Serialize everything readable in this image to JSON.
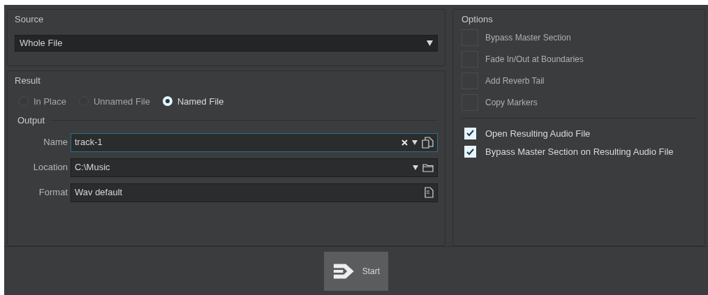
{
  "source": {
    "title": "Source",
    "value": "Whole File"
  },
  "result": {
    "title": "Result",
    "modes": [
      {
        "label": "In Place",
        "selected": false
      },
      {
        "label": "Unnamed File",
        "selected": false
      },
      {
        "label": "Named File",
        "selected": true
      }
    ],
    "output": {
      "title": "Output",
      "fields": [
        {
          "kind": "name",
          "label": "Name",
          "value": "track-1",
          "focused": true
        },
        {
          "kind": "location",
          "label": "Location",
          "value": "C:\\Music",
          "focused": false
        },
        {
          "kind": "format",
          "label": "Format",
          "value": "Wav default",
          "focused": false
        }
      ]
    }
  },
  "options": {
    "title": "Options",
    "groups": [
      [
        {
          "label": "Bypass Master Section",
          "checked": false
        },
        {
          "label": "Fade In/Out at Boundaries",
          "checked": false
        },
        {
          "label": "Add Reverb Tail",
          "checked": false
        },
        {
          "label": "Copy Markers",
          "checked": false
        }
      ],
      [
        {
          "label": "Open Resulting Audio File",
          "checked": true
        },
        {
          "label": "Bypass Master Section on Resulting Audio File",
          "checked": true
        }
      ]
    ]
  },
  "start_button": {
    "label": "Start"
  }
}
